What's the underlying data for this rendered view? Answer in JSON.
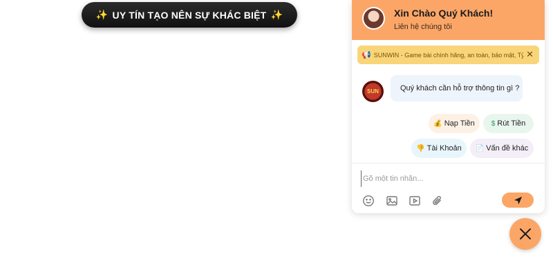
{
  "banner": {
    "text": "UY TÍN TẠO NÊN SỰ KHÁC BIỆT",
    "sparkle_icon": "✨"
  },
  "chat": {
    "header": {
      "title": "Xin Chào Quý Khách!",
      "subtitle": "Liên hệ chúng tôi",
      "avatar_icon": "agent-avatar"
    },
    "notice": {
      "icon": "📢",
      "text": "SUNWIN - Game bài chính hãng, an toàn, bảo mật, Tỷ",
      "close_icon": "✕"
    },
    "bot": {
      "avatar_text": "SUN",
      "message": "Quý khách cần hỗ trợ thông tin gì ?"
    },
    "quick_replies": [
      {
        "icon": "💰",
        "label": "Nạp Tiền"
      },
      {
        "icon": "$",
        "label": "Rút Tiền"
      },
      {
        "icon": "👎",
        "label": "Tài Khoản"
      },
      {
        "icon": "📄",
        "label": "Vấn đề khác"
      }
    ],
    "composer": {
      "placeholder": "Gõ một tin nhắn...",
      "tools": [
        "emoji-icon",
        "image-icon",
        "video-icon",
        "attachment-icon"
      ],
      "send_icon": "send-icon"
    }
  },
  "fab": {
    "close_icon": "close-icon"
  },
  "colors": {
    "accent": "#fba667",
    "notice_bg": "#f9d57a",
    "bubble_bg": "#eef4fb",
    "banner_bg": "#1a1a1a"
  }
}
